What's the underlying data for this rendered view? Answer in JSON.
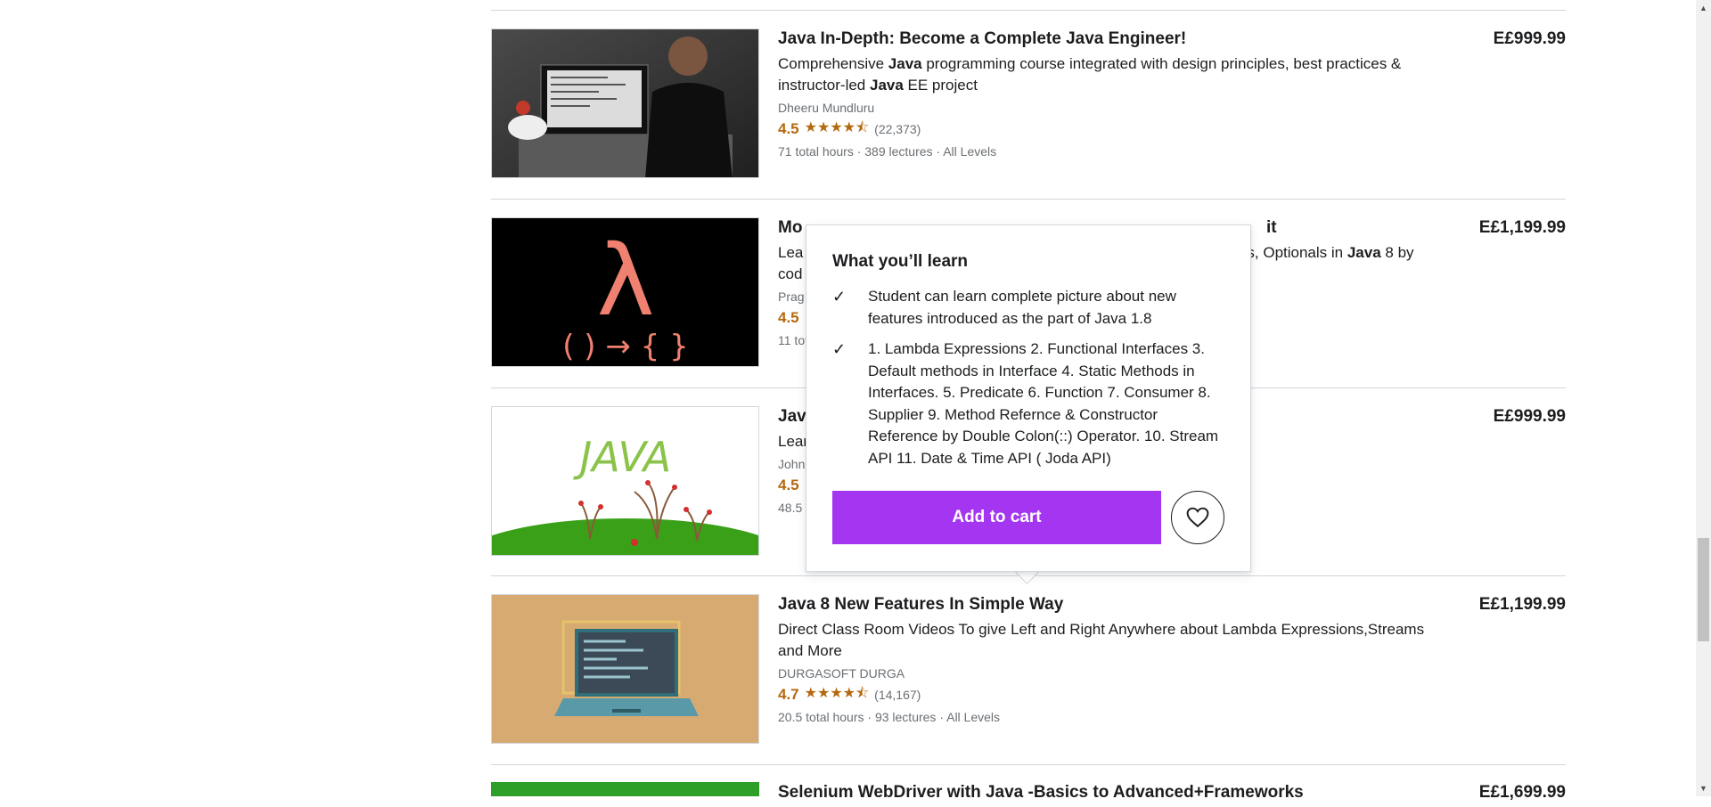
{
  "courses": [
    {
      "title": "Java In-Depth: Become a Complete Java Engineer!",
      "headline_parts": [
        "Comprehensive ",
        "Java",
        " programming course integrated with design principles, best practices & instructor-led ",
        "Java",
        " EE project"
      ],
      "instructor": "Dheeru Mundluru",
      "rating": "4.5",
      "stars": "★★★★⯪",
      "reviews": "(22,373)",
      "meta": "71 total hours · 389 lectures · All Levels",
      "price": "E£999.99",
      "thumb_icon": "instructor-laptop-image"
    },
    {
      "title_visible": "Mo",
      "title_tail": "it",
      "headline_start": "Lea",
      "headline_tail_parts": [
        "APIs, Optionals in ",
        "Java",
        " 8 by"
      ],
      "headline_line2": "cod",
      "instructor": "Prag",
      "rating": "4.5",
      "meta": "11 tot",
      "price": "E£1,199.99",
      "thumb_icon": "lambda-image"
    },
    {
      "title_visible": "Jav",
      "headline_start": "Lear",
      "instructor": "John",
      "rating": "4.5",
      "meta": "48.5",
      "price": "E£999.99",
      "thumb_icon": "java-logo-image"
    },
    {
      "title": "Java 8 New Features In Simple Way",
      "headline": "Direct Class Room Videos To give Left and Right Anywhere about Lambda Expressions,Streams and More",
      "instructor": "DURGASOFT DURGA",
      "rating": "4.7",
      "stars": "★★★★⯪",
      "reviews": "(14,167)",
      "meta": "20.5 total hours · 93 lectures · All Levels",
      "price": "E£1,199.99",
      "thumb_icon": "laptop-illustration-image"
    },
    {
      "title": "Selenium WebDriver with Java -Basics to Advanced+Frameworks",
      "price": "E£1,699.99",
      "thumb_icon": "green-thumbnail-image"
    }
  ],
  "popover": {
    "title": "What you’ll learn",
    "items": [
      "Student can learn complete picture about new features introduced as the part of Java 1.8",
      "1. Lambda Expressions 2. Functional Interfaces 3. Default methods in Interface 4. Static Methods in Interfaces. 5. Predicate 6. Function 7. Consumer 8. Supplier 9. Method Refernce & Constructor Reference by Double Colon(::) Operator. 10. Stream API 11. Date & Time API ( Joda API)"
    ],
    "add_to_cart": "Add to cart",
    "wishlist_icon": "heart-icon"
  },
  "colors": {
    "accent": "#a435f0",
    "rating": "#b4690e",
    "text": "#1c1d1f",
    "muted": "#6a6f73"
  }
}
